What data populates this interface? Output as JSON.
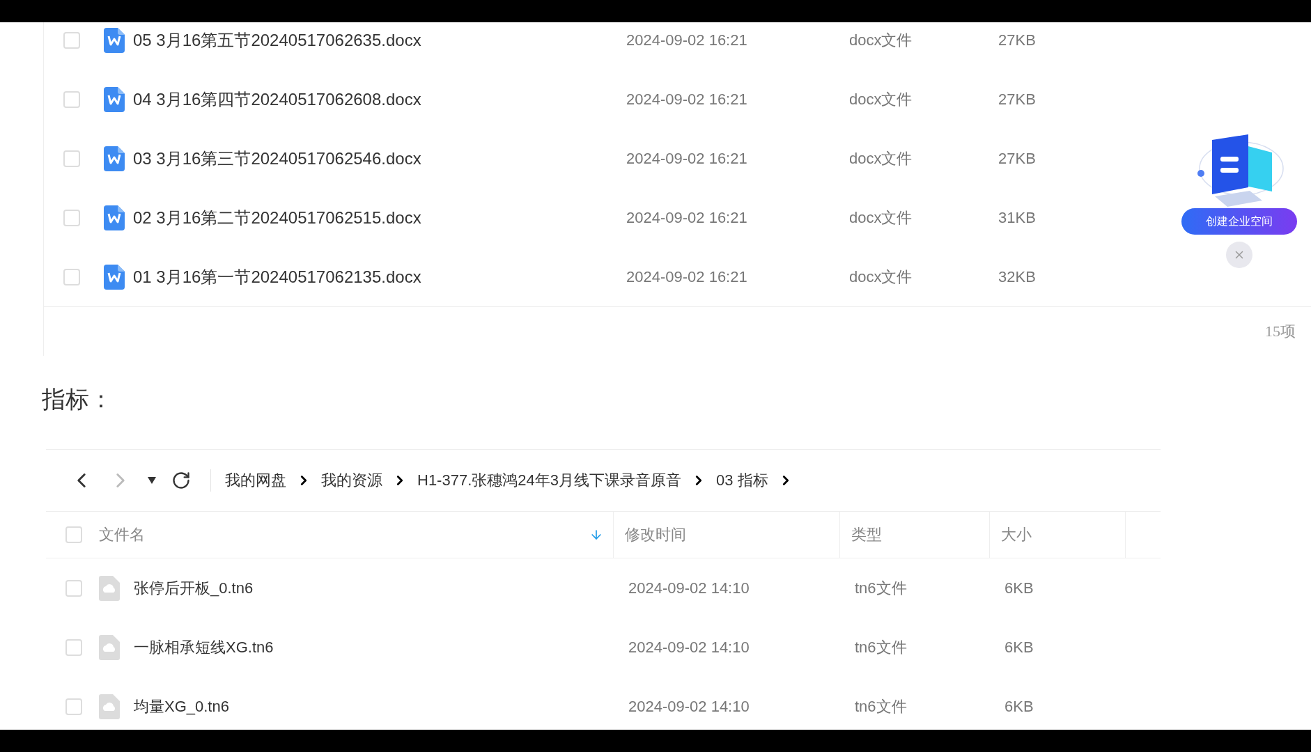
{
  "top_table": {
    "rows": [
      {
        "name": "05 3月16第五节20240517062635.docx",
        "modified": "2024-09-02 16:21",
        "type": "docx文件",
        "size": "27KB",
        "checked": false
      },
      {
        "name": "04 3月16第四节20240517062608.docx",
        "modified": "2024-09-02 16:21",
        "type": "docx文件",
        "size": "27KB",
        "checked": false
      },
      {
        "name": "03 3月16第三节20240517062546.docx",
        "modified": "2024-09-02 16:21",
        "type": "docx文件",
        "size": "27KB",
        "checked": false
      },
      {
        "name": "02 3月16第二节20240517062515.docx",
        "modified": "2024-09-02 16:21",
        "type": "docx文件",
        "size": "31KB",
        "checked": false
      },
      {
        "name": "01 3月16第一节20240517062135.docx",
        "modified": "2024-09-02 16:21",
        "type": "docx文件",
        "size": "32KB",
        "checked": false
      }
    ],
    "count": "15项"
  },
  "promo": {
    "label": "创建企业空间"
  },
  "heading": "指标：",
  "bottom_table": {
    "nav": [
      {
        "kind": "back",
        "disabled": false
      },
      {
        "kind": "forward",
        "disabled": true
      },
      {
        "kind": "history",
        "disabled": false
      },
      {
        "kind": "refresh",
        "disabled": false
      }
    ],
    "breadcrumb": [
      "我的网盘",
      "我的资源",
      "H1-377.张穗鸿24年3月线下课录音原音",
      "03 指标"
    ],
    "header_checked": false,
    "columns": [
      {
        "label": "文件名",
        "sorted": true
      },
      {
        "label": "修改时间",
        "sorted": false
      },
      {
        "label": "类型",
        "sorted": false
      },
      {
        "label": "大小",
        "sorted": false
      }
    ],
    "rows": [
      {
        "name": "张停后开板_0.tn6",
        "modified": "2024-09-02 14:10",
        "type": "tn6文件",
        "size": "6KB",
        "checked": false
      },
      {
        "name": "一脉相承短线XG.tn6",
        "modified": "2024-09-02 14:10",
        "type": "tn6文件",
        "size": "6KB",
        "checked": false
      },
      {
        "name": "均量XG_0.tn6",
        "modified": "2024-09-02 14:10",
        "type": "tn6文件",
        "size": "6KB",
        "checked": false
      }
    ]
  }
}
